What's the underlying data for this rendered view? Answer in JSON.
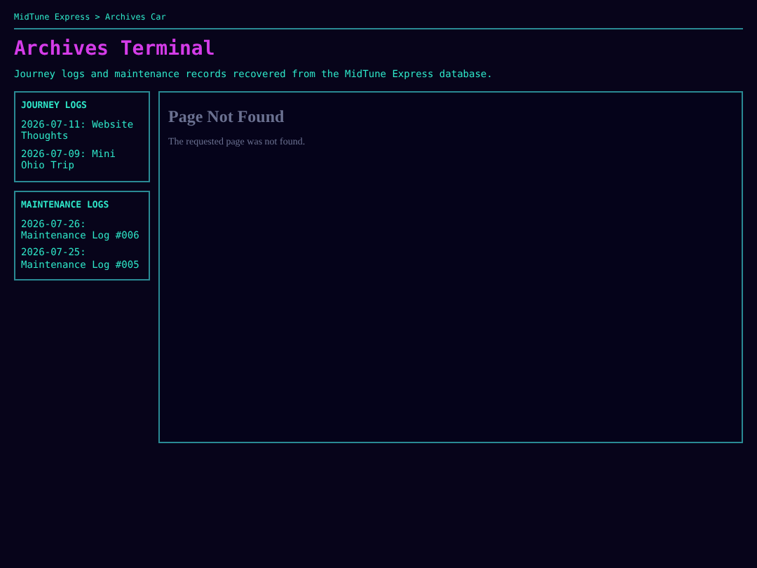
{
  "breadcrumb": "MidTune Express > Archives Car",
  "title": "Archives Terminal",
  "subtitle": "Journey logs and maintenance records recovered from the MidTune Express database.",
  "sidebar": [
    {
      "heading": "JOURNEY LOGS",
      "items": [
        "2026-07-11: Website Thoughts",
        "2026-07-09: Mini Ohio Trip"
      ]
    },
    {
      "heading": "MAINTENANCE LOGS",
      "items": [
        "2026-07-26: Maintenance Log #006",
        "2026-07-25: Maintenance Log #005"
      ]
    }
  ],
  "viewer": {
    "heading": "Page Not Found",
    "message": "The requested page was not found."
  }
}
